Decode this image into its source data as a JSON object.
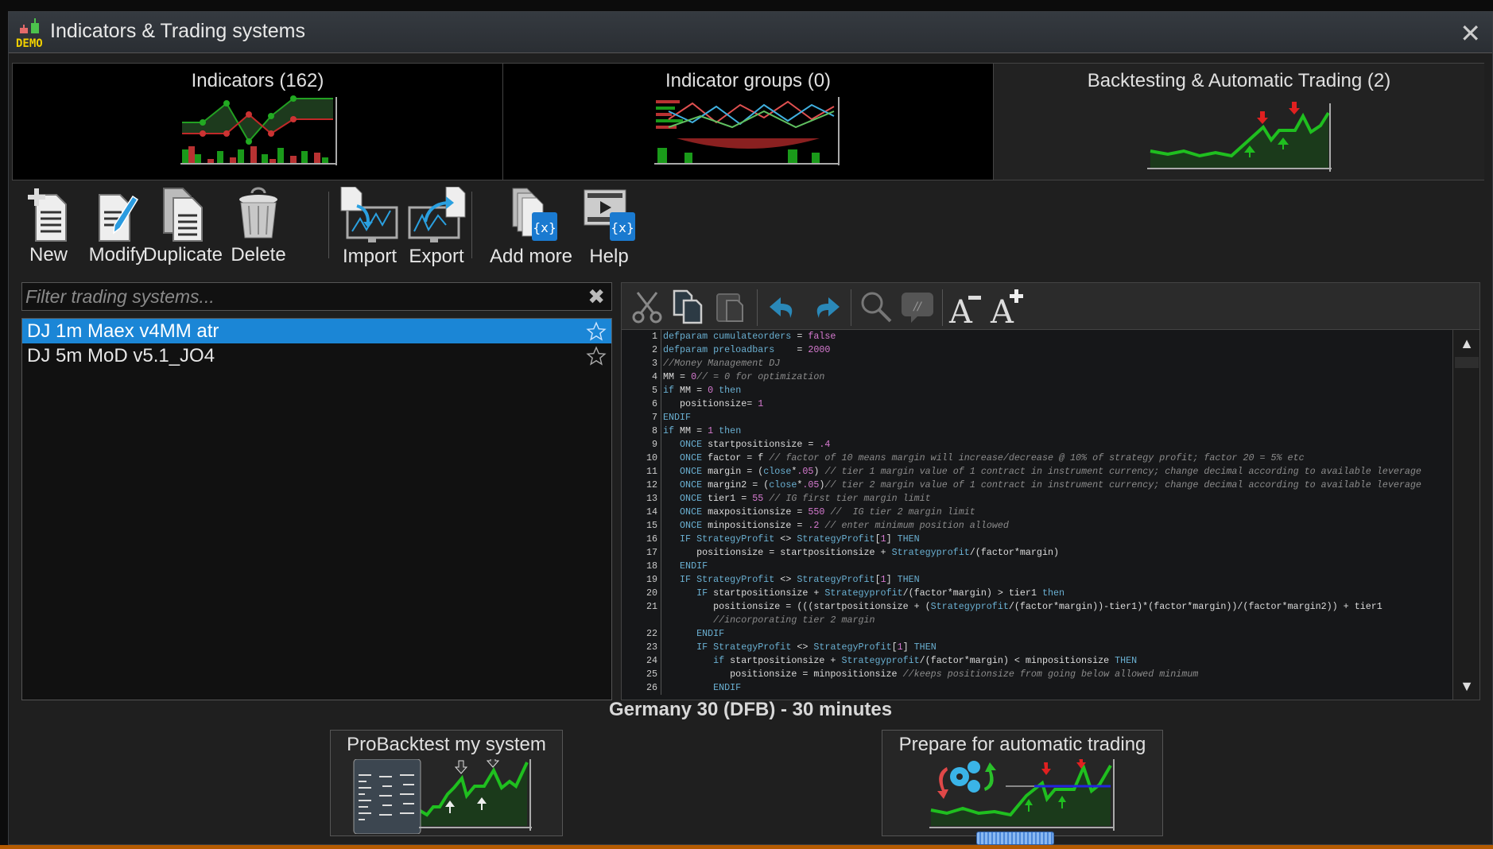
{
  "window": {
    "title": "Indicators & Trading systems",
    "badge": "DEMO",
    "close_icon": "close-icon"
  },
  "tabs": [
    {
      "label": "Indicators (162)",
      "active": false
    },
    {
      "label": "Indicator groups (0)",
      "active": false
    },
    {
      "label": "Backtesting & Automatic Trading (2)",
      "active": true
    }
  ],
  "toolbar": {
    "new": "New",
    "modify": "Modify",
    "duplicate": "Duplicate",
    "delete": "Delete",
    "import": "Import",
    "export": "Export",
    "add_more": "Add more",
    "help": "Help"
  },
  "filter": {
    "placeholder": "Filter trading systems...",
    "value": ""
  },
  "systems": [
    {
      "name": "DJ 1m Maex v4MM atr",
      "selected": true,
      "favorite": true
    },
    {
      "name": "DJ 5m MoD v5.1_JO4",
      "selected": false,
      "favorite": false
    }
  ],
  "editor_toolbar": [
    "cut-icon",
    "copy-icon",
    "paste-icon",
    "undo-icon",
    "redo-icon",
    "search-icon",
    "comment-icon",
    "font-decrease-icon",
    "font-increase-icon"
  ],
  "code": [
    {
      "n": "1",
      "t": "defparam cumulateorders = false"
    },
    {
      "n": "2",
      "t": "defparam preloadbars    = 2000"
    },
    {
      "n": "3",
      "t": "//Money Management DJ"
    },
    {
      "n": "4",
      "t": "MM = 0// = 0 for optimization"
    },
    {
      "n": "5",
      "t": "if MM = 0 then"
    },
    {
      "n": "6",
      "t": "   positionsize= 1"
    },
    {
      "n": "7",
      "t": "ENDIF"
    },
    {
      "n": "8",
      "t": "if MM = 1 then"
    },
    {
      "n": "9",
      "t": "   ONCE startpositionsize = .4"
    },
    {
      "n": "10",
      "t": "   ONCE factor = f // factor of 10 means margin will increase/decrease @ 10% of strategy profit; factor 20 = 5% etc"
    },
    {
      "n": "11",
      "t": "   ONCE margin = (close*.05) // tier 1 margin value of 1 contract in instrument currency; change decimal according to available leverage"
    },
    {
      "n": "12",
      "t": "   ONCE margin2 = (close*.05)// tier 2 margin value of 1 contract in instrument currency; change decimal according to available leverage"
    },
    {
      "n": "13",
      "t": "   ONCE tier1 = 55 // IG first tier margin limit"
    },
    {
      "n": "14",
      "t": "   ONCE maxpositionsize = 550 //  IG tier 2 margin limit"
    },
    {
      "n": "15",
      "t": "   ONCE minpositionsize = .2 // enter minimum position allowed"
    },
    {
      "n": "16",
      "t": "   IF StrategyProfit <> StrategyProfit[1] THEN"
    },
    {
      "n": "17",
      "t": "      positionsize = startpositionsize + Strategyprofit/(factor*margin)"
    },
    {
      "n": "18",
      "t": "   ENDIF"
    },
    {
      "n": "19",
      "t": "   IF StrategyProfit <> StrategyProfit[1] THEN"
    },
    {
      "n": "20",
      "t": "      IF startpositionsize + Strategyprofit/(factor*margin) > tier1 then"
    },
    {
      "n": "21",
      "t": "         positionsize = (((startpositionsize + (Strategyprofit/(factor*margin))-tier1)*(factor*margin))/(factor*margin2)) + tier1"
    },
    {
      "n": "",
      "t": "         //incorporating tier 2 margin"
    },
    {
      "n": "22",
      "t": "      ENDIF"
    },
    {
      "n": "23",
      "t": "      IF StrategyProfit <> StrategyProfit[1] THEN"
    },
    {
      "n": "24",
      "t": "         if startpositionsize + Strategyprofit/(factor*margin) < minpositionsize THEN"
    },
    {
      "n": "25",
      "t": "            positionsize = minpositionsize //keeps positionsize from going below allowed minimum"
    },
    {
      "n": "26",
      "t": "         ENDIF"
    }
  ],
  "instrument": "Germany 30 (DFB) - 30 minutes",
  "actions": {
    "backtest": "ProBacktest my system",
    "auto_trading": "Prepare for automatic trading"
  },
  "colors": {
    "selection": "#1b86d6",
    "keyword": "#6ab0d2",
    "number": "#d67ad0",
    "comment": "#8c8c8c",
    "chart_green": "#1fa81f",
    "chart_red": "#c0392b",
    "accent_orange": "#b45a00"
  }
}
